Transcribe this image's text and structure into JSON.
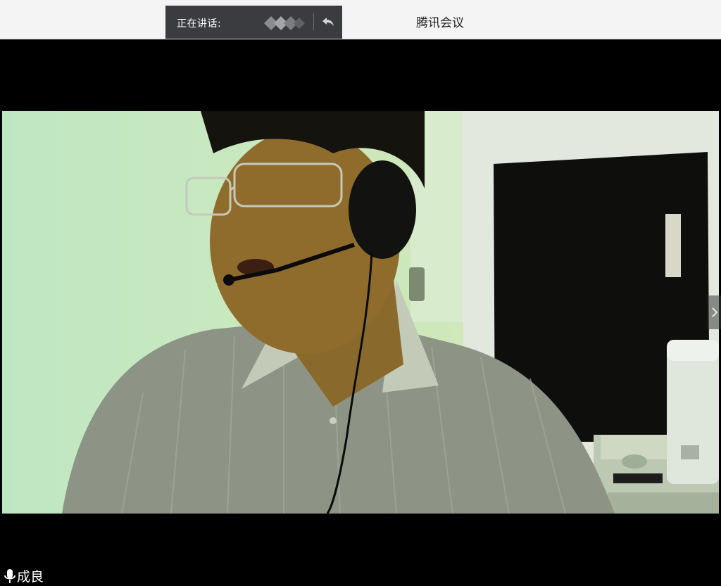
{
  "titlebar": {
    "speaking_label": "正在讲话:",
    "app_title": "腾讯会议"
  },
  "video": {
    "participant_name": "成良"
  },
  "icons": {
    "back": "reply-arrow-icon",
    "next": "chevron-right-icon",
    "mic": "microphone-icon"
  },
  "colors": {
    "titlebar_bg": "#f4f4f4",
    "speaking_bar_bg": "#3a3c40",
    "video_bg": "#000000"
  }
}
